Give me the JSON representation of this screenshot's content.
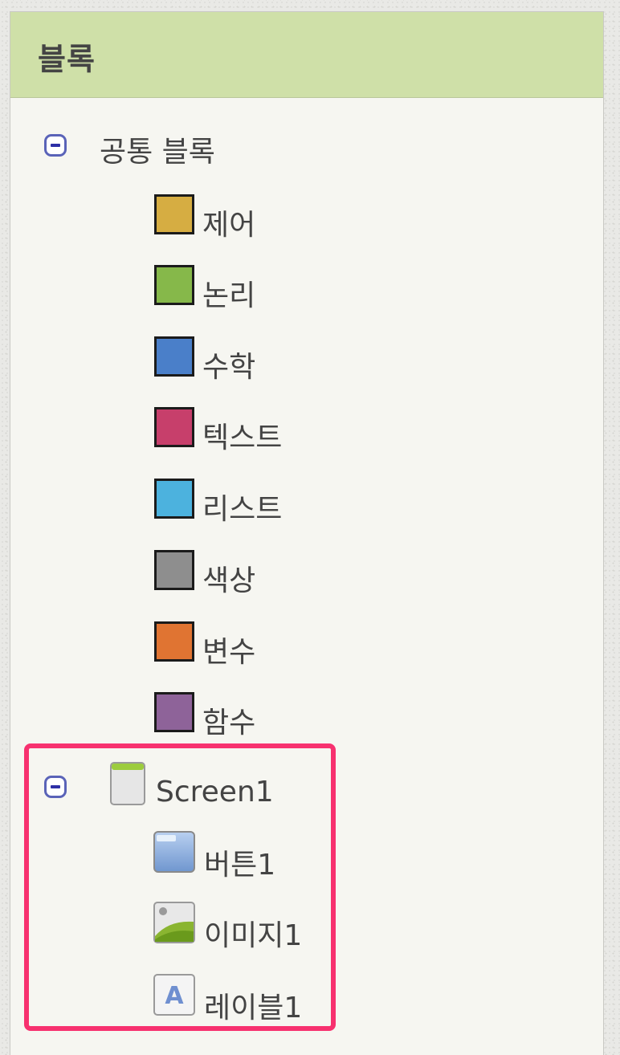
{
  "panel": {
    "title": "블록"
  },
  "builtin_group": {
    "label": "공통 블록",
    "items": [
      {
        "label": "제어",
        "color": "#d6ad42"
      },
      {
        "label": "논리",
        "color": "#86b84a"
      },
      {
        "label": "수학",
        "color": "#4a7fc9"
      },
      {
        "label": "텍스트",
        "color": "#c73f6b"
      },
      {
        "label": "리스트",
        "color": "#4cb2de"
      },
      {
        "label": "색상",
        "color": "#8e8e8e"
      },
      {
        "label": "변수",
        "color": "#e07432"
      },
      {
        "label": "함수",
        "color": "#8e6399"
      }
    ]
  },
  "screen_group": {
    "label": "Screen1",
    "icon": "screen-icon",
    "items": [
      {
        "label": "버튼1",
        "icon": "button-component-icon"
      },
      {
        "label": "이미지1",
        "icon": "image-component-icon"
      },
      {
        "label": "레이블1",
        "icon": "label-component-icon"
      }
    ]
  },
  "colors": {
    "header_bg": "#cfe0a8",
    "panel_bg": "#f6f6f1",
    "highlight": "#f7316f",
    "toggle": "#2d2fa6"
  }
}
